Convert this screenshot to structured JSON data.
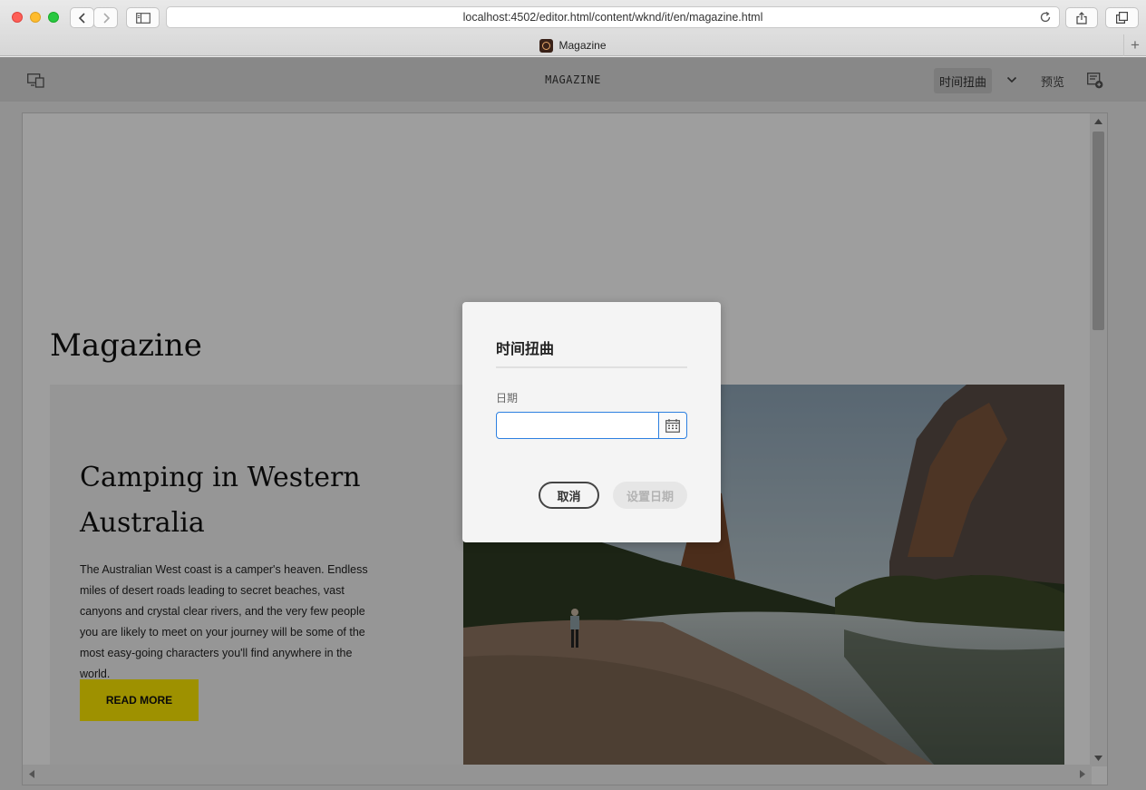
{
  "browser": {
    "url": "localhost:4502/editor.html/content/wknd/it/en/magazine.html",
    "tab_title": "Magazine",
    "new_tab_label": "+"
  },
  "editor_header": {
    "title": "MAGAZINE",
    "timewarp_label": "时间扭曲",
    "preview_label": "预览"
  },
  "page": {
    "title": "Magazine",
    "teaser": {
      "heading": "Camping in Western Australia",
      "body": "The Australian West coast is a camper's heaven. Endless miles of desert roads leading to secret beaches, vast canyons and crystal clear rivers, and the very few people you are likely to meet on your journey will be some of the most easy-going characters you'll find anywhere in the world.",
      "button_label": "READ MORE"
    }
  },
  "dialog": {
    "title": "时间扭曲",
    "date_label": "日期",
    "date_value": "",
    "cancel_label": "取消",
    "set_date_label": "设置日期"
  },
  "colors": {
    "accent": "#2d80e0",
    "cta": "#ffea00"
  }
}
